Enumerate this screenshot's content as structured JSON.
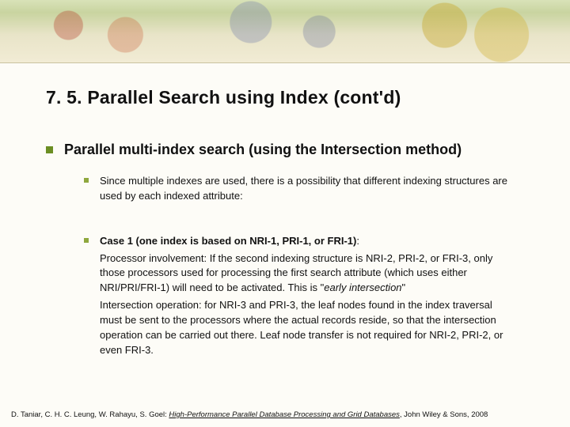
{
  "title": "7. 5. Parallel Search using Index (cont'd)",
  "heading": "Parallel multi-index search (using the Intersection method)",
  "point1": "Since multiple indexes are used, there is a possibility that different indexing structures are used by each indexed attribute:",
  "case_label": "Case 1 (one index is based on NRI-1, PRI-1, or FRI-1)",
  "case_colon": ":",
  "para1": "  Processor involvement: If the second indexing structure is NRI-2, PRI-2, or FRI-3, only those processors used for processing the first search attribute (which uses either NRI/PRI/FRI-1) will need to be activated. This is \"",
  "early": "early intersection",
  "para1_end": "\"",
  "para2": "  Intersection operation: for NRI-3 and PRI-3, the leaf nodes found in the index traversal must be sent to the processors where the actual records reside, so that the intersection operation can be carried out there. Leaf node transfer is not required for NRI-2, PRI-2, or even FRI-3.",
  "footer_pre": "D. Taniar, C. H. C. Leung, W. Rahayu, S. Goel: ",
  "footer_title": "High-Performance Parallel Database Processing and Grid Databases",
  "footer_post": ", John Wiley & Sons, 2008"
}
